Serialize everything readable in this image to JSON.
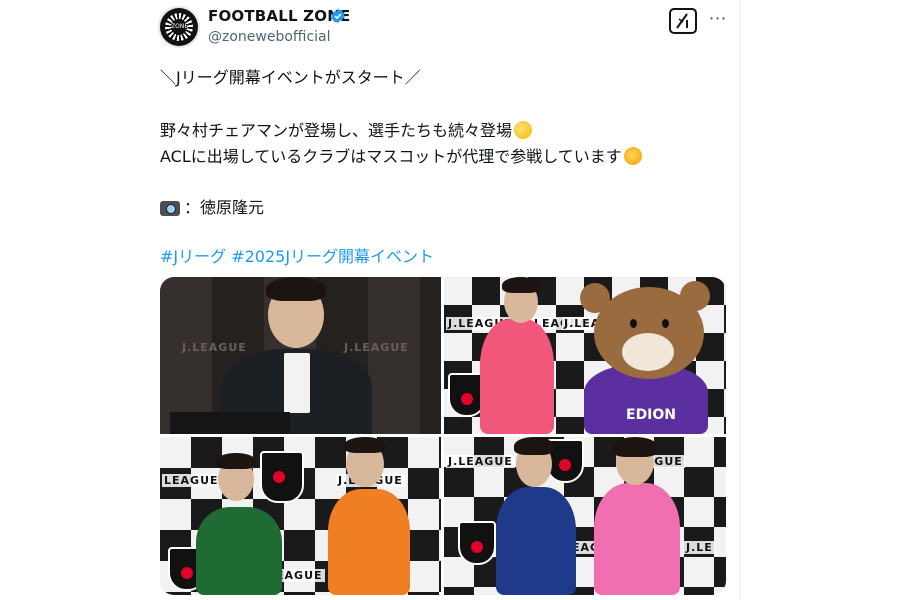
{
  "post": {
    "author_name": "FOOTBALL ZONE",
    "author_handle": "@zonewebofficial",
    "avatar_text": "ZONE",
    "lines": {
      "l1": "＼Jリーグ開幕イベントがスタート／",
      "l2": "野々村チェアマンが登場し、選手たちも続々登場",
      "l3": "ACLに出場しているクラブはマスコットが代理で参戦しています",
      "l4": "：徳原隆元",
      "hashtags": "#Jリーグ #2025Jリーグ開幕イベント"
    }
  },
  "photos": {
    "p1_labels": [
      "J.LEAGUE",
      "J.LEAGUE"
    ],
    "p2_labels": [
      "J.LEAGUE",
      "LEAGUE",
      "J.LEAGUE"
    ],
    "p2_mascot_text": "EDION",
    "p3_labels": [
      "LEAGUE",
      "J.LEAGUE",
      "LEAGUE"
    ],
    "p4_labels": [
      "J.LEAGUE",
      "J.LEAGUE",
      "LEAGUE",
      "J.LE"
    ]
  },
  "icons": {
    "verified": "verified-badge-icon",
    "grok": "grok-icon",
    "more": "more-options-icon",
    "clap": "clapping-hand-emoji",
    "party": "party-face-emoji",
    "camera": "camera-emoji"
  },
  "colors": {
    "link": "#1d9bf0",
    "verified": "#1d9bf0",
    "text": "#0f1419",
    "muted": "#536471"
  }
}
